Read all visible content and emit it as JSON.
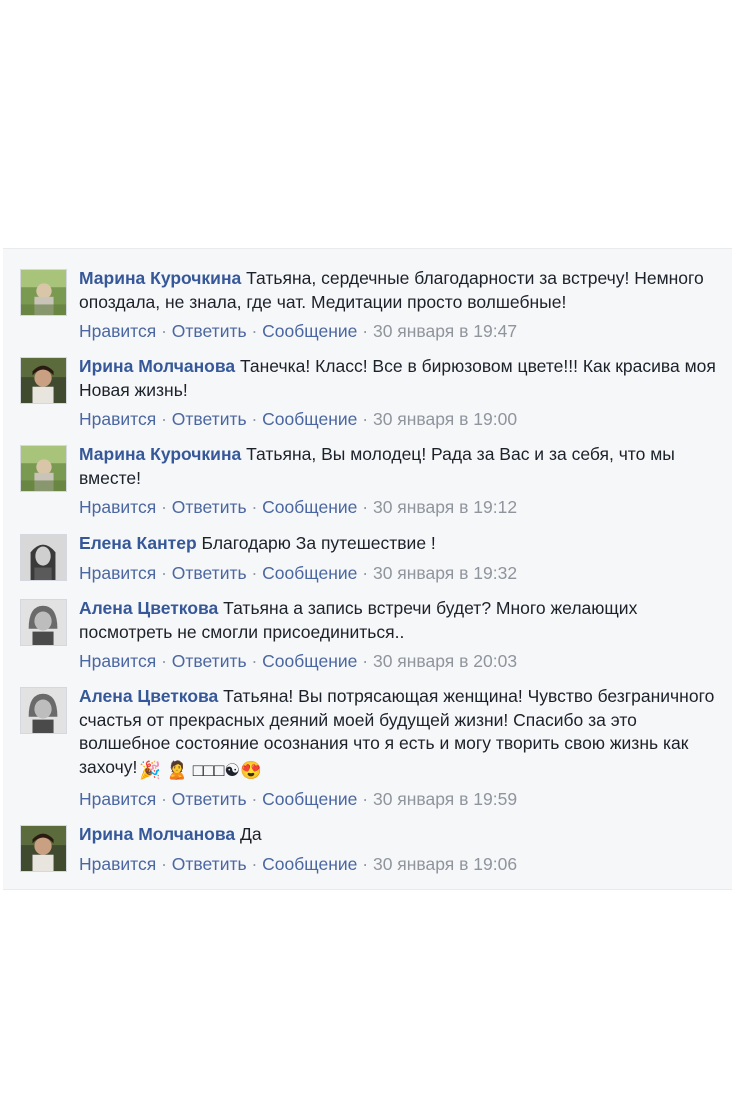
{
  "comments": [
    {
      "author": "Марина Курочкина",
      "text": "Татьяна, сердечные благодарности за встречу! Немного опоздала, не знала, где чат. Медитации просто волшебные!",
      "like": "Нравится",
      "reply": "Ответить",
      "message": "Сообщение",
      "time": "30 января в 19:47",
      "avatar": "marina-avatar"
    },
    {
      "author": "Ирина Молчанова",
      "text": "Танечка! Класс! Все в бирюзовом цвете!!! Как красива моя Новая жизнь!",
      "like": "Нравится",
      "reply": "Ответить",
      "message": "Сообщение",
      "time": "30 января в 19:00",
      "avatar": "irina-avatar"
    },
    {
      "author": "Марина Курочкина",
      "text": "Татьяна, Вы молодец! Рада за Вас и за себя, что мы вместе!",
      "like": "Нравится",
      "reply": "Ответить",
      "message": "Сообщение",
      "time": "30 января в 19:12",
      "avatar": "marina-avatar"
    },
    {
      "author": "Елена Кантер",
      "text": "Благодарю За путешествие !",
      "like": "Нравится",
      "reply": "Ответить",
      "message": "Сообщение",
      "time": "30 января в 19:32",
      "avatar": "elena-avatar"
    },
    {
      "author": "Алена Цветкова",
      "text": "Татьяна а запись встречи будет? Много желающих посмотреть не смогли присоединиться..",
      "like": "Нравится",
      "reply": "Ответить",
      "message": "Сообщение",
      "time": "30 января в 20:03",
      "avatar": "alena-avatar"
    },
    {
      "author": "Алена Цветкова",
      "text": "Татьяна! Вы потрясающая женщина! Чувство безграничного счастья от прекрасных деяний моей будущей жизни! Спасибо за это волшебное состояние осознания что я есть и могу творить свою жизнь как захочу!",
      "emoji_tail": "🎉 🙎 □□□☯😍",
      "like": "Нравится",
      "reply": "Ответить",
      "message": "Сообщение",
      "time": "30 января в 19:59",
      "avatar": "alena-avatar"
    },
    {
      "author": "Ирина Молчанова",
      "text": "Да",
      "like": "Нравится",
      "reply": "Ответить",
      "message": "Сообщение",
      "time": "30 января в 19:06",
      "avatar": "irina-avatar"
    }
  ],
  "colors": {
    "author": "#365899",
    "link": "#4b67a1",
    "meta": "#90949c",
    "text": "#1d2129",
    "panel": "#f6f7f9"
  }
}
